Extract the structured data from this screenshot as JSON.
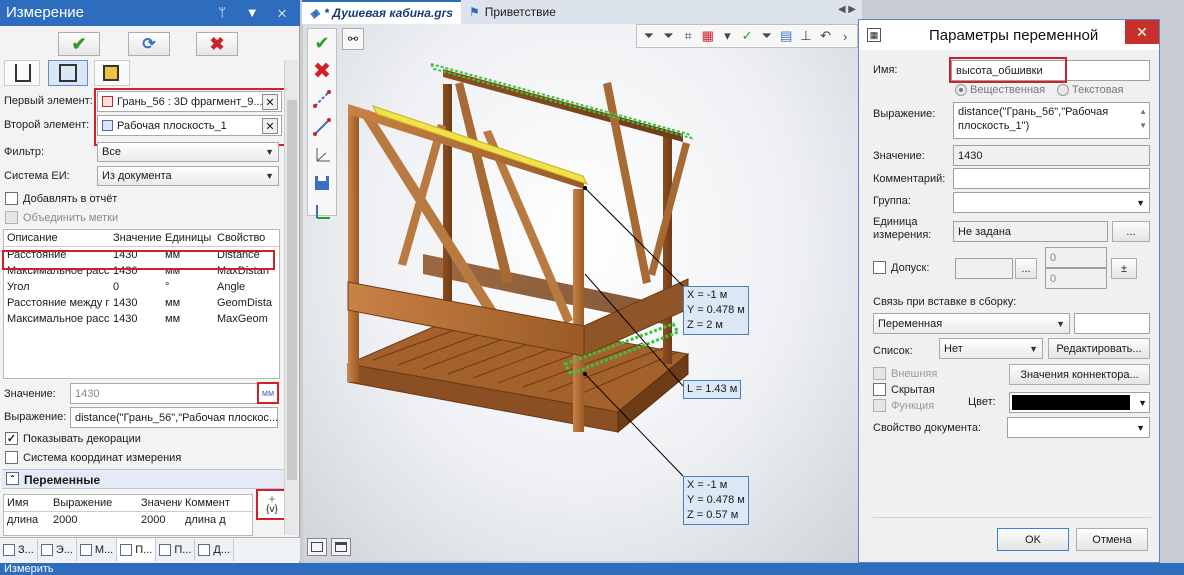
{
  "left_panel": {
    "title": "Измерение",
    "title_icons": "ᛘ ▼ ✕",
    "actions": {
      "ok": "✔",
      "refresh": "⟳",
      "cancel": "✖"
    },
    "first_element_label": "Первый элемент:",
    "first_element_value": "Грань_56 : 3D фрагмент_9...",
    "second_element_label": "Второй элемент:",
    "second_element_value": "Рабочая плоскость_1",
    "filter_label": "Фильтр:",
    "filter_value": "Все",
    "units_label": "Система ЕИ:",
    "units_value": "Из документа",
    "add_to_report": "Добавлять в отчёт",
    "merge_marks": "Объединить метки",
    "table": {
      "headers": [
        "Описание",
        "Значение",
        "Единицы",
        "Свойство"
      ],
      "rows": [
        [
          "Расстояние",
          "1430",
          "мм",
          "Distance"
        ],
        [
          "Максимальное расс",
          "1430",
          "мм",
          "MaxDistan"
        ],
        [
          "Угол",
          "0",
          "°",
          "Angle"
        ],
        [
          "Расстояние между г",
          "1430",
          "мм",
          "GeomDista"
        ],
        [
          "Максимальное расс",
          "1430",
          "мм",
          "MaxGeom"
        ]
      ]
    },
    "value_label": "Значение:",
    "value_value": "1430",
    "value_unit": "мм",
    "expr_label": "Выражение:",
    "expr_value": "distance(\"Грань_56\",\"Рабочая плоскос...",
    "show_decor": "Показывать декорации",
    "coord_sys": "Система координат измерения",
    "vars_section": "Переменные",
    "vars_headers": [
      "Имя",
      "Выражение",
      "Значени",
      "Коммент"
    ],
    "vars_rows": [
      [
        "длина",
        "2000",
        "2000",
        "длина д"
      ]
    ],
    "add_var_icon": "{v}",
    "bottom_tabs": [
      "З...",
      "Э...",
      "М...",
      "П...",
      "П...",
      "Д..."
    ]
  },
  "doc_tabs": {
    "active": "* Душевая кабина.grs",
    "other": "Приветствие",
    "nav_arrows": "◀ ▶"
  },
  "viewport": {
    "tools": {
      "ok": "✔",
      "cancel": "✖"
    },
    "measures": {
      "upper": [
        "X = -1 м",
        "Y = 0.478 м",
        "Z = 2 м"
      ],
      "length": "L = 1.43 м",
      "lower": [
        "X = -1 м",
        "Y = 0.478 м",
        "Z = 0.57 м"
      ]
    }
  },
  "dialog": {
    "title": "Параметры переменной",
    "close": "✕",
    "name_label": "Имя:",
    "name_value": "высота_обшивки",
    "type_real": "Вещественная",
    "type_text": "Текстовая",
    "expr_label": "Выражение:",
    "expr_value": "distance(\"Грань_56\",\"Рабочая плоскость_1\")",
    "value_label": "Значение:",
    "value_value": "1430",
    "comment_label": "Комментарий:",
    "group_label": "Группа:",
    "unit_label_1": "Единица",
    "unit_label_2": "измерения:",
    "unit_value": "Не задана",
    "ellipsis": "...",
    "tolerance_label": "Допуск:",
    "tol_upper": "0",
    "tol_lower": "0",
    "pm": "±",
    "link_label": "Связь при вставке в сборку:",
    "link_value": "Переменная",
    "list_label": "Список:",
    "list_value": "Нет",
    "edit_btn": "Редактировать...",
    "external": "Внешняя",
    "hidden": "Скрытая",
    "function": "Функция",
    "connector_btn": "Значения коннектора...",
    "color_label": "Цвет:",
    "color_value": "#000000",
    "doc_prop_label": "Свойство документа:",
    "ok": "OK",
    "cancel": "Отмена"
  },
  "status_bar": "Измерить",
  "colors": {
    "accent": "#2e6dbd",
    "highlight": "#d0202a",
    "wood": "#b76e34"
  }
}
